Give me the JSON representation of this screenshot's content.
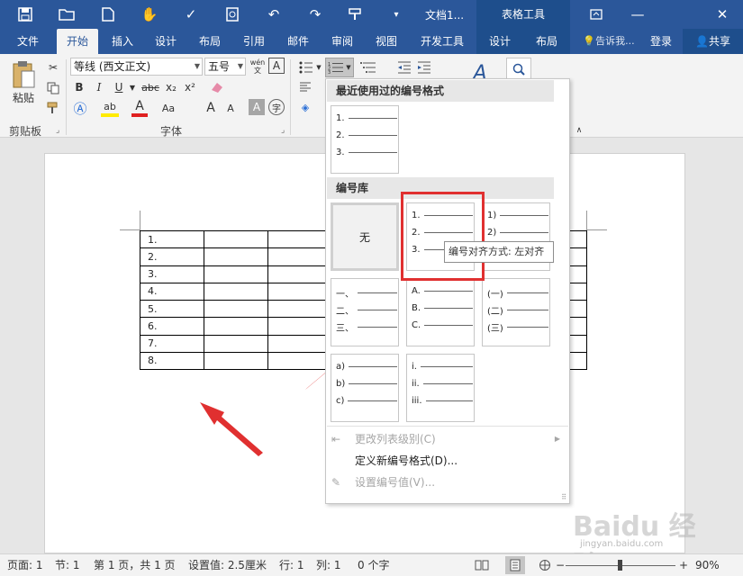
{
  "titlebar": {
    "doc_title": "文档1...",
    "context_title": "表格工具",
    "icons": [
      "save-icon",
      "open-folder-icon",
      "new-doc-icon",
      "touch-icon",
      "spell-check-icon",
      "print-preview-icon",
      "undo-icon",
      "redo-icon",
      "paint-format-icon",
      "customize-icon",
      "ribbon-display-icon",
      "minimize-icon",
      "close-icon"
    ]
  },
  "tabs": [
    {
      "label": "文件"
    },
    {
      "label": "开始"
    },
    {
      "label": "插入"
    },
    {
      "label": "设计"
    },
    {
      "label": "布局"
    },
    {
      "label": "引用"
    },
    {
      "label": "邮件"
    },
    {
      "label": "审阅"
    },
    {
      "label": "视图"
    },
    {
      "label": "开发工具"
    },
    {
      "label": "设计"
    },
    {
      "label": "布局"
    }
  ],
  "tellme": "告诉我...",
  "login": "登录",
  "share": "共享",
  "ribbon": {
    "paste": "粘贴",
    "clipboard_label": "剪贴板",
    "font_name": "等线 (西文正文)",
    "font_size": "五号",
    "font_group_label": "字体",
    "wen": "wén",
    "wen2": "文",
    "bold": "B",
    "italic": "I",
    "underline": "U",
    "strike": "abc",
    "sub": "x₂",
    "sup": "x²",
    "grow": "A",
    "shrink": "A",
    "aa": "Aa",
    "font_color_a": "A",
    "shade_a": "A",
    "enclose": "字",
    "style_a": "A"
  },
  "document": {
    "rows": [
      "1.",
      "2.",
      "3.",
      "4.",
      "5.",
      "6.",
      "7.",
      "8."
    ]
  },
  "dropdown": {
    "recent_header": "最近使用过的编号格式",
    "library_header": "编号库",
    "none_label": "无",
    "recent": [
      "1.",
      "2.",
      "3."
    ],
    "tiles": [
      [
        "1.",
        "2.",
        "3."
      ],
      [
        "1)",
        "2)",
        "3)"
      ],
      [
        "一、",
        "二、",
        "三、"
      ],
      [
        "A.",
        "B.",
        "C."
      ],
      [
        "(一)",
        "(二)",
        "(三)"
      ],
      [
        "a)",
        "b)",
        "c)"
      ],
      [
        "i.",
        "ii.",
        "iii."
      ]
    ],
    "tooltip": "编号对齐方式: 左对齐",
    "menu": {
      "change_level": "更改列表级别(C)",
      "define_new": "定义新编号格式(D)...",
      "set_value": "设置编号值(V)..."
    }
  },
  "statusbar": {
    "page": "页面: 1",
    "section": "节: 1",
    "page_of": "第 1 页，共 1 页",
    "setting": "设置值: 2.5厘米",
    "line": "行: 1",
    "col": "列: 1",
    "chars": "0 个字",
    "zoom": "90%"
  },
  "watermark": {
    "text": "Baidu 经验",
    "url": "jingyan.baidu.com"
  },
  "colors": {
    "accent": "#2b579a",
    "highlight": "#e03030",
    "arrow": "#e03030"
  }
}
